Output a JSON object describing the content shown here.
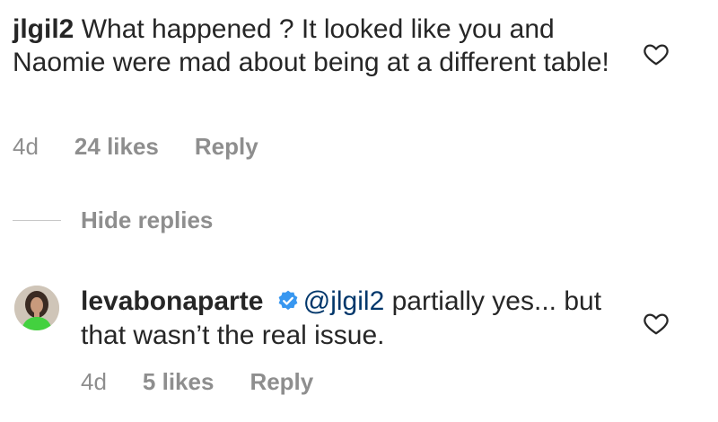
{
  "comment": {
    "username": "jlgil2",
    "text": " What happened ?  It looked like you and Naomie were mad about being at a different table!",
    "time": "4d",
    "likes": "24 likes",
    "reply_label": "Reply"
  },
  "hide_replies_label": "Hide replies",
  "reply": {
    "username": "levabonaparte",
    "mention": "@jlgil2",
    "text": " partially yes... but that wasn’t the real issue.",
    "time": "4d",
    "likes": "5 likes",
    "reply_label": "Reply"
  },
  "icons": {
    "like": "heart-outline-icon",
    "verified": "verified-badge-icon"
  },
  "colors": {
    "primary_text": "#262626",
    "secondary_text": "#8e8e8e",
    "mention": "#00376b",
    "verified": "#3897f0"
  }
}
